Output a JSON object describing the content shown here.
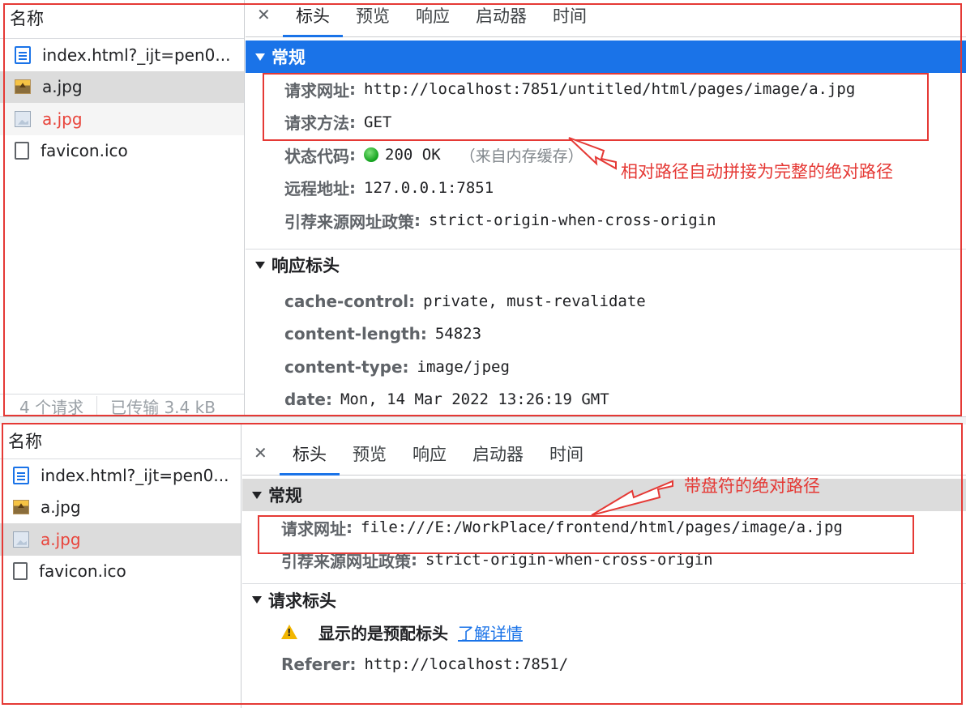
{
  "top": {
    "list_header": "名称",
    "requests": [
      {
        "name": "index.html?_ijt=pen0...",
        "icon": "document-icon"
      },
      {
        "name": "a.jpg",
        "icon": "image-icon"
      },
      {
        "name": "a.jpg",
        "icon": "broken-image-icon"
      },
      {
        "name": "favicon.ico",
        "icon": "blank-file-icon"
      }
    ],
    "footer": {
      "requests": "4 个请求",
      "transferred": "已传输 3.4 kB"
    },
    "close": "✕",
    "tabs": [
      "标头",
      "预览",
      "响应",
      "启动器",
      "时间"
    ],
    "general": {
      "title": "常规",
      "rows": [
        {
          "key": "请求网址",
          "value": "http://localhost:7851/untitled/html/pages/image/a.jpg"
        },
        {
          "key": "请求方法",
          "value": "GET"
        },
        {
          "key": "状态代码",
          "value": "200 OK",
          "note": "（来自内存缓存）"
        },
        {
          "key": "远程地址",
          "value": "127.0.0.1:7851"
        },
        {
          "key": "引荐来源网址政策",
          "value": "strict-origin-when-cross-origin"
        }
      ]
    },
    "response_headers": {
      "title": "响应标头",
      "rows": [
        {
          "key": "cache-control",
          "value": "private, must-revalidate"
        },
        {
          "key": "content-length",
          "value": "54823"
        },
        {
          "key": "content-type",
          "value": "image/jpeg"
        },
        {
          "key": "date",
          "value": "Mon, 14 Mar 2022 13:26:19 GMT"
        }
      ]
    },
    "annotation": "相对路径自动拼接为完整的绝对路径"
  },
  "bottom": {
    "list_header": "名称",
    "requests": [
      {
        "name": "index.html?_ijt=pen0...",
        "icon": "document-icon"
      },
      {
        "name": "a.jpg",
        "icon": "image-icon"
      },
      {
        "name": "a.jpg",
        "icon": "broken-image-icon"
      },
      {
        "name": "favicon.ico",
        "icon": "blank-file-icon"
      }
    ],
    "close": "✕",
    "tabs": [
      "标头",
      "预览",
      "响应",
      "启动器",
      "时间"
    ],
    "general": {
      "title": "常规",
      "rows": [
        {
          "key": "请求网址",
          "value": "file:///E:/WorkPlace/frontend/html/pages/image/a.jpg"
        },
        {
          "key": "引荐来源网址政策",
          "value": "strict-origin-when-cross-origin"
        }
      ]
    },
    "request_headers": {
      "title": "请求标头",
      "warning": "显示的是预配标头",
      "link": "了解详情",
      "rows": [
        {
          "key": "Referer",
          "value": "http://localhost:7851/"
        }
      ]
    },
    "annotation": "带盘符的绝对路径"
  },
  "colors": {
    "accent": "#1a73e8",
    "annotation": "#e53935",
    "error": "#e8453c"
  }
}
